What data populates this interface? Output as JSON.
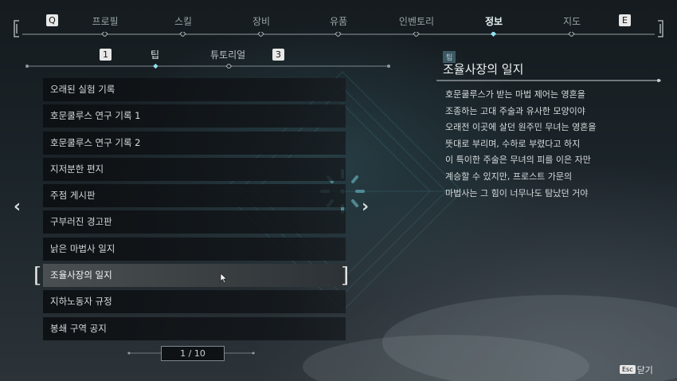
{
  "nav": {
    "tabs": [
      {
        "label": "프로필",
        "active": false
      },
      {
        "label": "스킬",
        "active": false
      },
      {
        "label": "장비",
        "active": false
      },
      {
        "label": "유품",
        "active": false
      },
      {
        "label": "인벤토리",
        "active": false
      },
      {
        "label": "정보",
        "active": true
      },
      {
        "label": "지도",
        "active": false
      }
    ],
    "prev_key": "Q",
    "next_key": "E"
  },
  "subtabs": {
    "prev_key": "1",
    "next_key": "3",
    "items": [
      {
        "label": "팁",
        "active": true
      },
      {
        "label": "튜토리얼",
        "active": false
      }
    ]
  },
  "list": {
    "items": [
      "오래된 실험 기록",
      "호문쿨루스 연구 기록 1",
      "호문쿨루스 연구 기록 2",
      "지저분한 편지",
      "주점 게시판",
      "구부러진 경고판",
      "낡은 마법사 일지",
      "조율사장의 일지",
      "지하노동자 규정",
      "봉쇄 구역 공지"
    ],
    "selected_index": 7
  },
  "pager": {
    "text": "1 / 10"
  },
  "detail": {
    "tag": "팁",
    "title": "조율사장의 일지",
    "lines": [
      "호문쿨루스가 받는 마법 제어는 영혼을",
      "조종하는 고대 주술과 유사한 모양이야",
      "오래전 이곳에 살던 원주민 무녀는 영혼을",
      "뜻대로 부리며, 수하로 부렸다고 하지",
      "이 특이한 주술은 무녀의 피를 이은 자만",
      "계승할 수 있지만, 프로스트 가문의",
      "마법사는 그 힘이 너무나도 탐났던 거야"
    ]
  },
  "footer": {
    "key": "Esc",
    "close_label": "닫기"
  },
  "colors": {
    "accent": "#7fd6e6",
    "selected_row": "#4a4f52"
  }
}
